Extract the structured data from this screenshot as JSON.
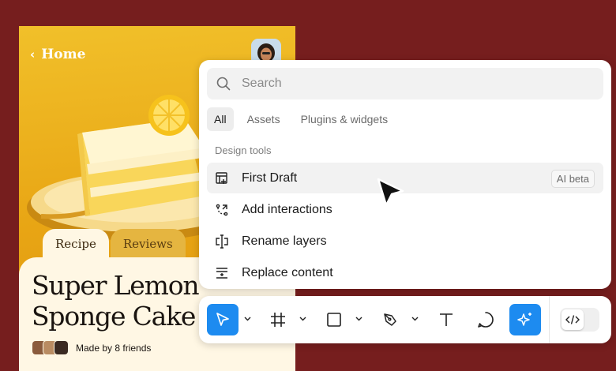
{
  "recipe_card": {
    "back_label": "Home",
    "tabs": [
      {
        "label": "Recipe"
      },
      {
        "label": "Reviews"
      }
    ],
    "title": "Super Lemon Sponge Cake",
    "friends_text": "Made by 8 friends"
  },
  "panel": {
    "search_placeholder": "Search",
    "filter_tabs": [
      {
        "label": "All"
      },
      {
        "label": "Assets"
      },
      {
        "label": "Plugins & widgets"
      }
    ],
    "section_label": "Design tools",
    "commands": [
      {
        "label": "First Draft",
        "icon": "first-draft-icon",
        "badge": "AI beta"
      },
      {
        "label": "Add interactions",
        "icon": "interactions-icon"
      },
      {
        "label": "Rename layers",
        "icon": "rename-icon"
      },
      {
        "label": "Replace content",
        "icon": "replace-content-icon"
      }
    ]
  },
  "toolbar": {
    "tools": [
      {
        "name": "move-tool",
        "icon": "cursor-arrow-icon",
        "active": true
      },
      {
        "name": "frame-tool",
        "icon": "frame-hash-icon"
      },
      {
        "name": "shape-tool",
        "icon": "rectangle-icon"
      },
      {
        "name": "pen-tool",
        "icon": "pen-nib-icon"
      },
      {
        "name": "text-tool",
        "icon": "text-t-icon"
      },
      {
        "name": "comment-tool",
        "icon": "comment-bubble-icon"
      },
      {
        "name": "ai-tool",
        "icon": "sparkle-icon",
        "active": true
      },
      {
        "name": "dev-mode-toggle",
        "icon": "code-brackets-icon"
      }
    ]
  },
  "colors": {
    "background": "#761e1e",
    "accent_blue": "#1d8bf0",
    "card_yellow": "#e8a514",
    "card_cream": "#fff7e4"
  }
}
